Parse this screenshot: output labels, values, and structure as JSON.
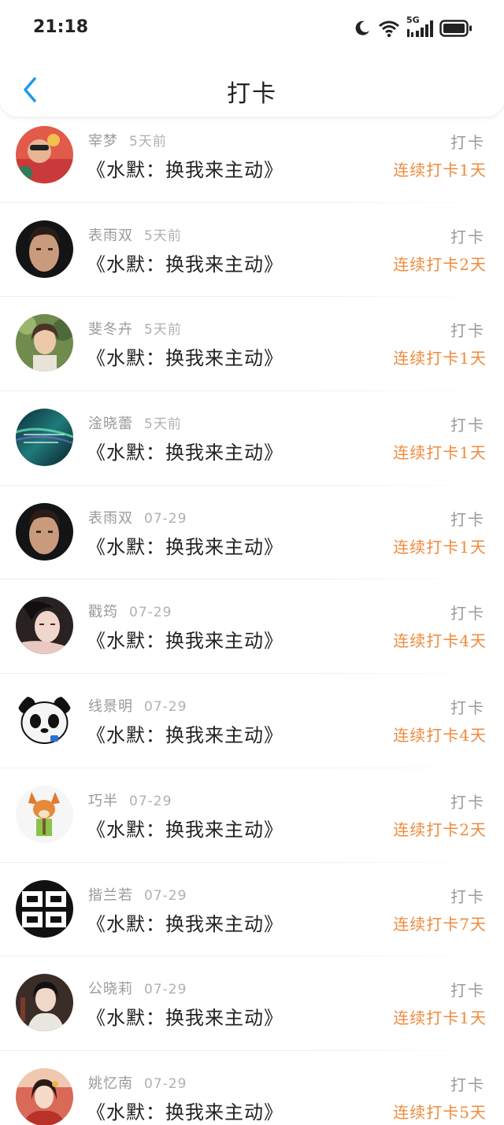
{
  "status_bar": {
    "time": "21:18",
    "icons": [
      "moon-icon",
      "wifi-icon",
      "5g-signal-icon",
      "battery-icon"
    ],
    "network_label": "5G"
  },
  "nav": {
    "title": "打卡",
    "back_icon": "chevron-left-icon"
  },
  "colors": {
    "accent_orange": "#ef8a3c",
    "back_blue": "#1e9be9",
    "muted_text": "#9a9a9a"
  },
  "records": [
    {
      "name": "宰梦",
      "time": "5天前",
      "book": "《水默：换我来主动》",
      "action": "打卡",
      "streak": "连续打卡1天"
    },
    {
      "name": "表雨双",
      "time": "5天前",
      "book": "《水默：换我来主动》",
      "action": "打卡",
      "streak": "连续打卡2天"
    },
    {
      "name": "斐冬卉",
      "time": "5天前",
      "book": "《水默：换我来主动》",
      "action": "打卡",
      "streak": "连续打卡1天"
    },
    {
      "name": "淦晓蕾",
      "time": "5天前",
      "book": "《水默：换我来主动》",
      "action": "打卡",
      "streak": "连续打卡1天"
    },
    {
      "name": "表雨双",
      "time": "07-29",
      "book": "《水默：换我来主动》",
      "action": "打卡",
      "streak": "连续打卡1天"
    },
    {
      "name": "戳筠",
      "time": "07-29",
      "book": "《水默：换我来主动》",
      "action": "打卡",
      "streak": "连续打卡4天"
    },
    {
      "name": "线景明",
      "time": "07-29",
      "book": "《水默：换我来主动》",
      "action": "打卡",
      "streak": "连续打卡4天"
    },
    {
      "name": "巧半",
      "time": "07-29",
      "book": "《水默：换我来主动》",
      "action": "打卡",
      "streak": "连续打卡2天"
    },
    {
      "name": "揩兰若",
      "time": "07-29",
      "book": "《水默：换我来主动》",
      "action": "打卡",
      "streak": "连续打卡7天"
    },
    {
      "name": "公晓莉",
      "time": "07-29",
      "book": "《水默：换我来主动》",
      "action": "打卡",
      "streak": "连续打卡1天"
    },
    {
      "name": "姚忆南",
      "time": "07-29",
      "book": "《水默：换我来主动》",
      "action": "打卡",
      "streak": "连续打卡5天"
    }
  ]
}
